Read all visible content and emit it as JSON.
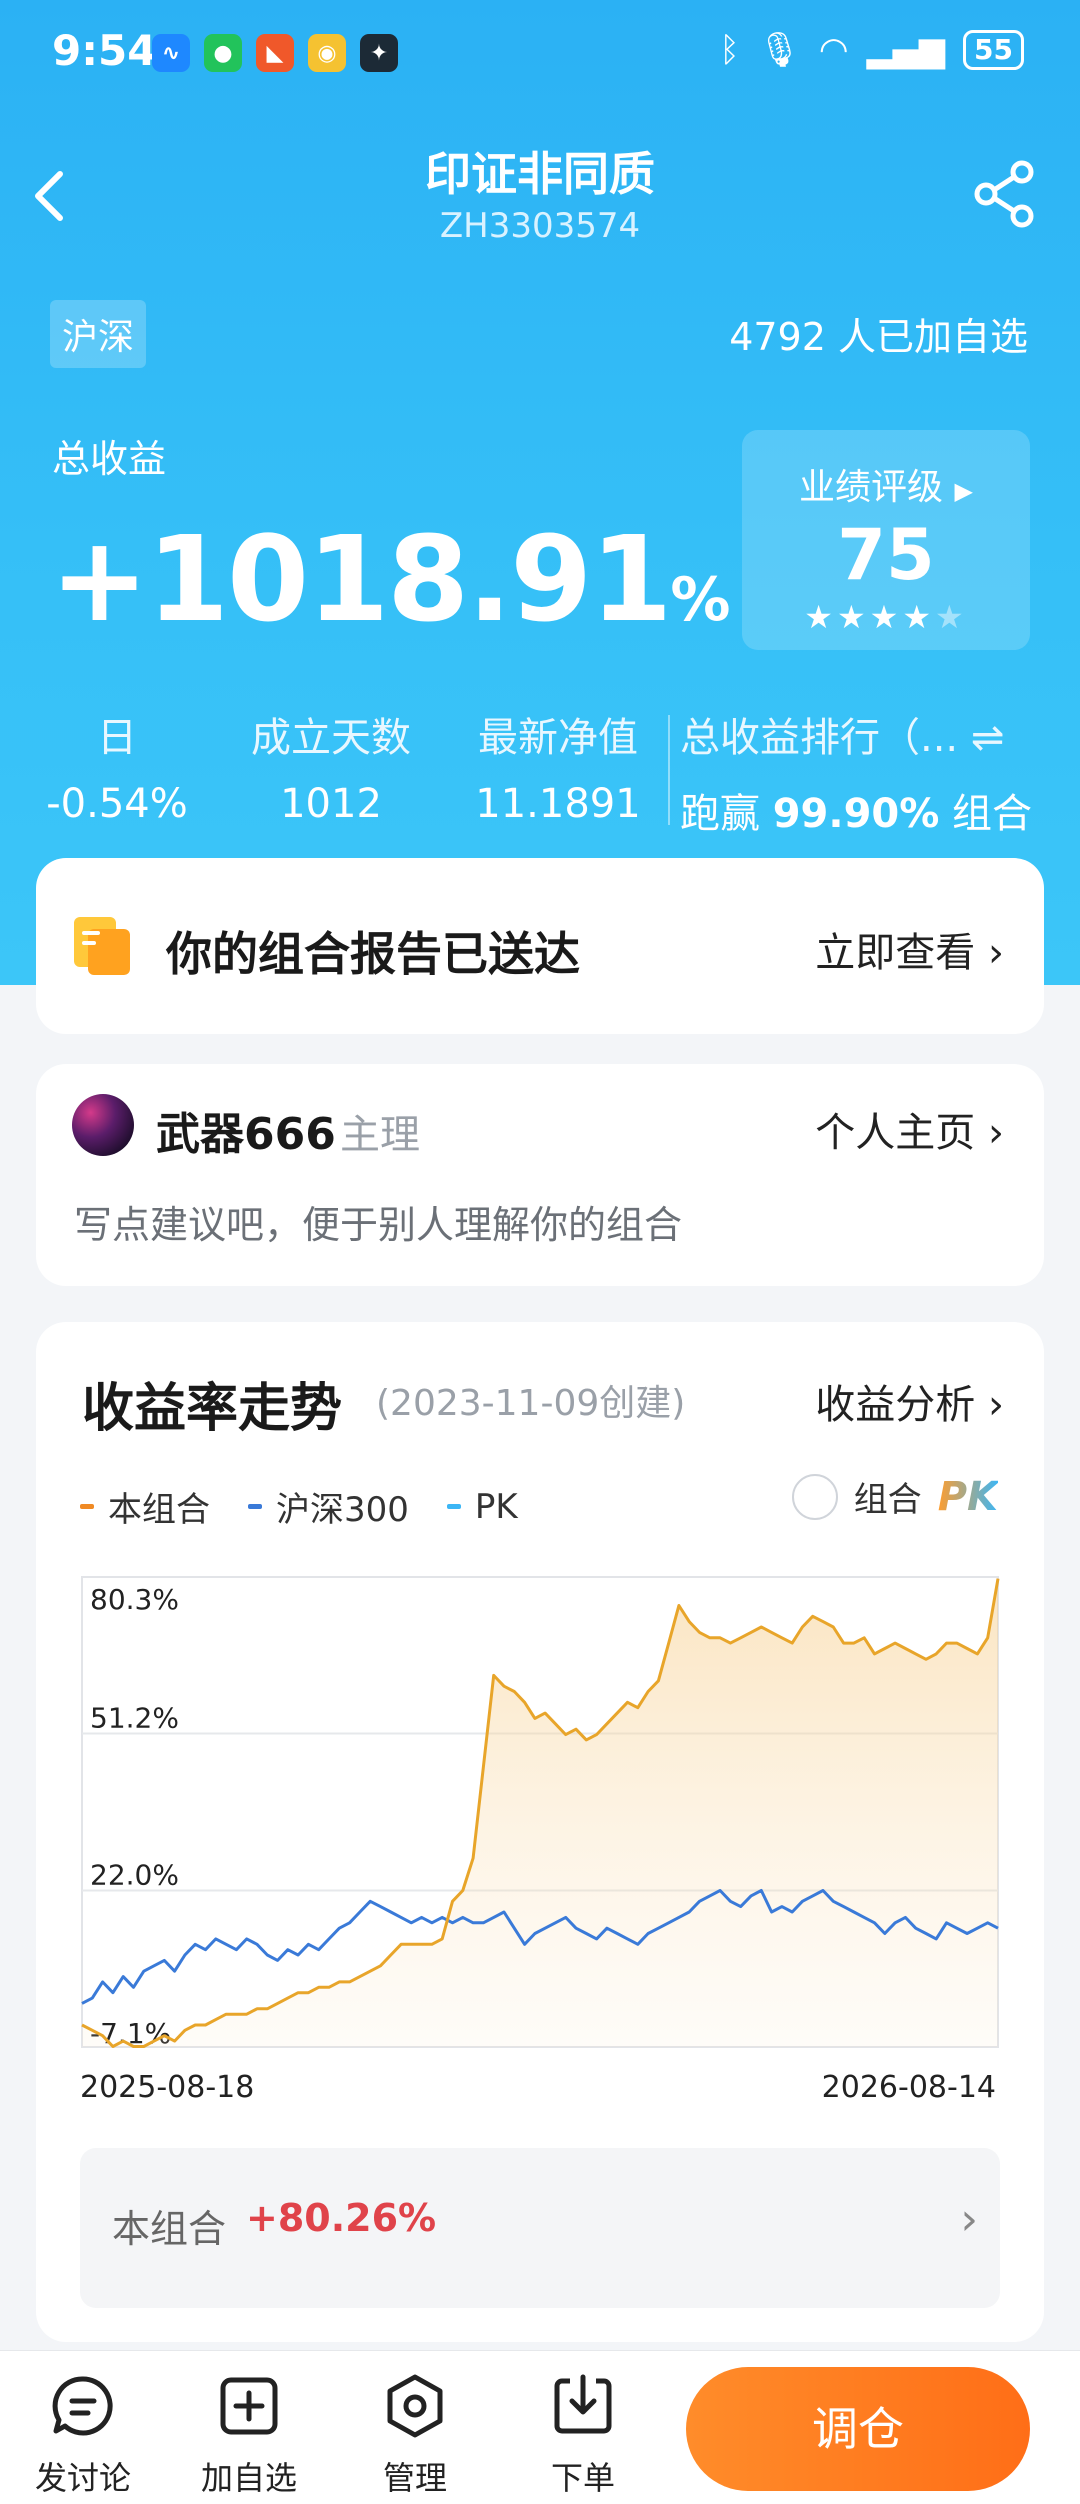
{
  "status_bar": {
    "time": "9:54",
    "battery": "55"
  },
  "header": {
    "title": "印证非同质",
    "code": "ZH3303574"
  },
  "market_tag": "沪深",
  "followers": "4792 人已加自选",
  "total_return": {
    "label": "总收益",
    "value": "+1018.91",
    "unit": "%"
  },
  "rating": {
    "label": "业绩评级",
    "score": "75",
    "stars_filled": 4,
    "stars_total": 5
  },
  "stats": [
    {
      "label": "日",
      "value": "-0.54%"
    },
    {
      "label": "成立天数",
      "value": "1012"
    },
    {
      "label": "最新净值",
      "value": "11.1891"
    }
  ],
  "rank": {
    "label": "总收益排行（...",
    "prefix": "跑赢",
    "value": "99.90%",
    "suffix": "组合"
  },
  "report_card": {
    "text": "你的组合报告已送达",
    "link": "立即查看"
  },
  "owner": {
    "name": "武器666",
    "role": "主理",
    "home_link": "个人主页",
    "hint": "写点建议吧，便于别人理解你的组合"
  },
  "chart_section": {
    "title": "收益率走势",
    "created": "(2023-11-09创建)",
    "link": "收益分析"
  },
  "legend": [
    {
      "name": "本组合",
      "color": "#f08a24"
    },
    {
      "name": "沪深300",
      "color": "#3a7ad8"
    },
    {
      "name": "PK",
      "color": "#3cb6f5"
    }
  ],
  "pk_toggle": {
    "label": "组合",
    "pk": "PK"
  },
  "summary": {
    "label": "本组合",
    "value": "+80.26%"
  },
  "bottom_tabs": [
    {
      "label": "发讨论",
      "icon": "discuss-icon"
    },
    {
      "label": "加自选",
      "icon": "add-watchlist-icon"
    },
    {
      "label": "管理",
      "icon": "manage-icon"
    },
    {
      "label": "下单",
      "icon": "order-icon"
    }
  ],
  "adjust_button": "调仓",
  "colors": {
    "header_blue": "#2bb1f4",
    "portfolio_line": "#e8a52a",
    "index_line": "#3a7ad8",
    "positive": "#e0434a",
    "cta_orange": "#ff7a1f"
  },
  "chart_data": {
    "type": "line",
    "x_start": "2025-08-18",
    "x_end": "2026-08-14",
    "y_ticks": [
      "80.3%",
      "51.2%",
      "22.0%",
      "-7.1%"
    ],
    "ylim": [
      -7.1,
      80.3
    ],
    "grid": true,
    "series": [
      {
        "name": "本组合",
        "color": "#e8a52a",
        "values": [
          -3,
          -4,
          -5,
          -7,
          -6,
          -7,
          -7,
          -6,
          -5,
          -6,
          -4,
          -3,
          -3,
          -2,
          -1,
          -1,
          -1,
          0,
          0,
          1,
          2,
          3,
          3,
          4,
          4,
          5,
          5,
          6,
          7,
          8,
          10,
          12,
          12,
          12,
          12,
          13,
          20,
          22,
          28,
          45,
          62,
          60,
          59,
          57,
          54,
          55,
          53,
          51,
          52,
          50,
          51,
          53,
          55,
          57,
          56,
          59,
          61,
          68,
          75,
          72,
          70,
          69,
          69,
          68,
          69,
          70,
          71,
          70,
          69,
          68,
          71,
          73,
          72,
          71,
          68,
          68,
          69,
          66,
          67,
          68,
          67,
          66,
          65,
          66,
          68,
          68,
          67,
          66,
          69,
          80
        ]
      },
      {
        "name": "沪深300",
        "color": "#3a7ad8",
        "values": [
          1,
          2,
          5,
          3,
          6,
          4,
          7,
          8,
          9,
          7,
          10,
          12,
          11,
          13,
          12,
          11,
          13,
          12,
          10,
          9,
          11,
          10,
          12,
          11,
          13,
          15,
          16,
          18,
          20,
          19,
          18,
          17,
          16,
          17,
          16,
          17,
          16,
          17,
          16,
          16,
          17,
          18,
          15,
          12,
          14,
          15,
          16,
          17,
          15,
          14,
          13,
          15,
          14,
          13,
          12,
          14,
          15,
          16,
          17,
          18,
          20,
          21,
          22,
          20,
          19,
          21,
          22,
          18,
          19,
          18,
          20,
          21,
          22,
          20,
          19,
          18,
          17,
          16,
          14,
          16,
          17,
          15,
          14,
          13,
          16,
          15,
          14,
          15,
          16,
          15
        ]
      }
    ]
  }
}
